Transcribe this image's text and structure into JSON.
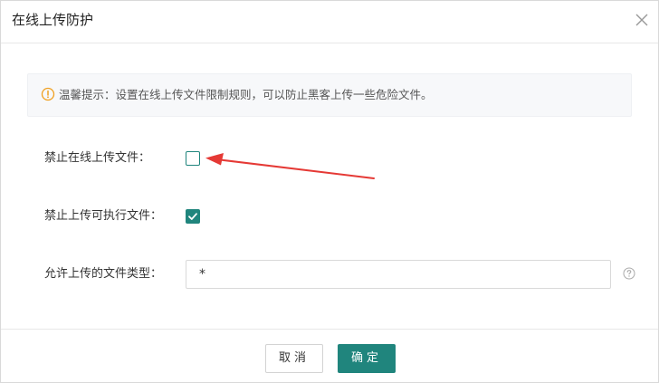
{
  "dialog": {
    "title": "在线上传防护"
  },
  "tip": {
    "text": "温馨提示：设置在线上传文件限制规则，可以防止黑客上传一些危险文件。"
  },
  "form": {
    "disable_online_upload": {
      "label": "禁止在线上传文件：",
      "checked": false
    },
    "disable_executable_upload": {
      "label": "禁止上传可执行文件：",
      "checked": true
    },
    "allowed_types": {
      "label": "允许上传的文件类型：",
      "value": "*"
    }
  },
  "footer": {
    "cancel_label": "取消",
    "confirm_label": "确定"
  },
  "colors": {
    "accent": "#20857d",
    "warning": "#f0a020",
    "annotation_arrow": "#e53935"
  },
  "icons": {
    "close": "close-icon",
    "tip": "warning-circle-icon",
    "help": "question-circle-icon",
    "check": "checkmark-icon"
  }
}
